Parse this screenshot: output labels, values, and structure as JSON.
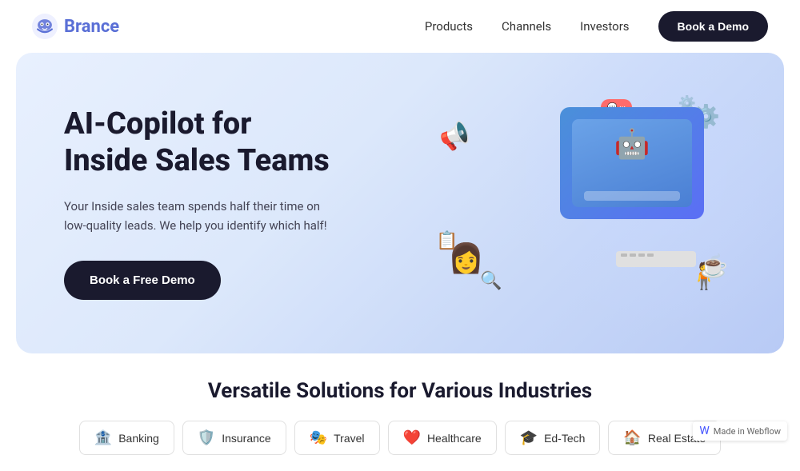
{
  "navbar": {
    "logo_text": "Brance",
    "nav_items": [
      {
        "label": "Products",
        "id": "products"
      },
      {
        "label": "Channels",
        "id": "channels"
      },
      {
        "label": "Investors",
        "id": "investors"
      }
    ],
    "cta_label": "Book a Demo"
  },
  "hero": {
    "title_line1": "AI-Copilot for",
    "title_line2": "Inside Sales Teams",
    "description": "Your Inside sales team spends half their time on low-quality leads. We help you identify which half!",
    "cta_label": "Book a Free Demo"
  },
  "industries_section": {
    "title": "Versatile Solutions for Various Industries",
    "tabs": [
      {
        "label": "Banking",
        "icon": "🏦",
        "id": "banking"
      },
      {
        "label": "Insurance",
        "icon": "🛡️",
        "id": "insurance"
      },
      {
        "label": "Travel",
        "icon": "🎭",
        "id": "travel"
      },
      {
        "label": "Healthcare",
        "icon": "❤️",
        "id": "healthcare"
      },
      {
        "label": "Ed-Tech",
        "icon": "🎓",
        "id": "edtech"
      },
      {
        "label": "Real Estate",
        "icon": "🏠",
        "id": "realestate"
      }
    ]
  },
  "webflow_badge": {
    "label": "Made in Webflow"
  }
}
